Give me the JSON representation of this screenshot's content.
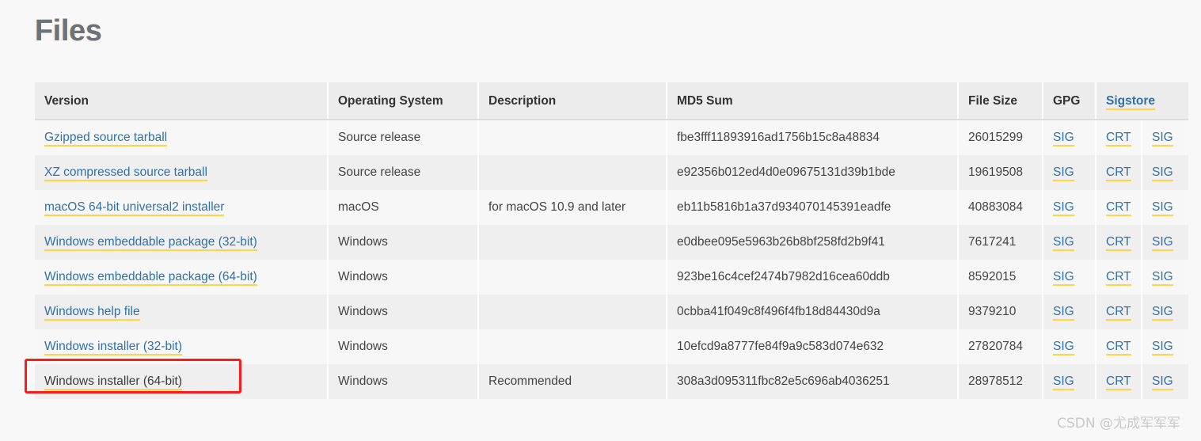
{
  "page": {
    "title": "Files",
    "watermark": "CSDN @尤成军军军"
  },
  "colors": {
    "link": "#3071a9",
    "link_underline": "#ffd343",
    "heading": "#6a737d",
    "highlight_box": "#fc1b1b",
    "header_bg": "#ececec",
    "row_odd_bg": "#f7f7f7",
    "row_even_bg": "#efefef",
    "page_bg": "#f8f8f8"
  },
  "table": {
    "headers": {
      "version": "Version",
      "os": "Operating System",
      "description": "Description",
      "md5": "MD5 Sum",
      "filesize": "File Size",
      "gpg": "GPG",
      "sigstore": "Sigstore"
    },
    "rows": [
      {
        "version": "Gzipped source tarball",
        "os": "Source release",
        "description": "",
        "md5": "fbe3fff11893916ad1756b15c8a48834",
        "filesize": "26015299",
        "gpg": "SIG",
        "crt": "CRT",
        "sig": "SIG",
        "visited": false
      },
      {
        "version": "XZ compressed source tarball",
        "os": "Source release",
        "description": "",
        "md5": "e92356b012ed4d0e09675131d39b1bde",
        "filesize": "19619508",
        "gpg": "SIG",
        "crt": "CRT",
        "sig": "SIG",
        "visited": false
      },
      {
        "version": "macOS 64-bit universal2 installer",
        "os": "macOS",
        "description": "for macOS 10.9 and later",
        "md5": "eb11b5816b1a37d934070145391eadfe",
        "filesize": "40883084",
        "gpg": "SIG",
        "crt": "CRT",
        "sig": "SIG",
        "visited": false
      },
      {
        "version": "Windows embeddable package (32-bit)",
        "os": "Windows",
        "description": "",
        "md5": "e0dbee095e5963b26b8bf258fd2b9f41",
        "filesize": "7617241",
        "gpg": "SIG",
        "crt": "CRT",
        "sig": "SIG",
        "visited": false
      },
      {
        "version": "Windows embeddable package (64-bit)",
        "os": "Windows",
        "description": "",
        "md5": "923be16c4cef2474b7982d16cea60ddb",
        "filesize": "8592015",
        "gpg": "SIG",
        "crt": "CRT",
        "sig": "SIG",
        "visited": false
      },
      {
        "version": "Windows help file",
        "os": "Windows",
        "description": "",
        "md5": "0cbba41f049c8f496f4fb18d84430d9a",
        "filesize": "9379210",
        "gpg": "SIG",
        "crt": "CRT",
        "sig": "SIG",
        "visited": false
      },
      {
        "version": "Windows installer (32-bit)",
        "os": "Windows",
        "description": "",
        "md5": "10efcd9a8777fe84f9a9c583d074e632",
        "filesize": "27820784",
        "gpg": "SIG",
        "crt": "CRT",
        "sig": "SIG",
        "visited": false
      },
      {
        "version": "Windows installer (64-bit)",
        "os": "Windows",
        "description": "Recommended",
        "md5": "308a3d095311fbc82e5c696ab4036251",
        "filesize": "28978512",
        "gpg": "SIG",
        "crt": "CRT",
        "sig": "SIG",
        "visited": true
      }
    ]
  }
}
